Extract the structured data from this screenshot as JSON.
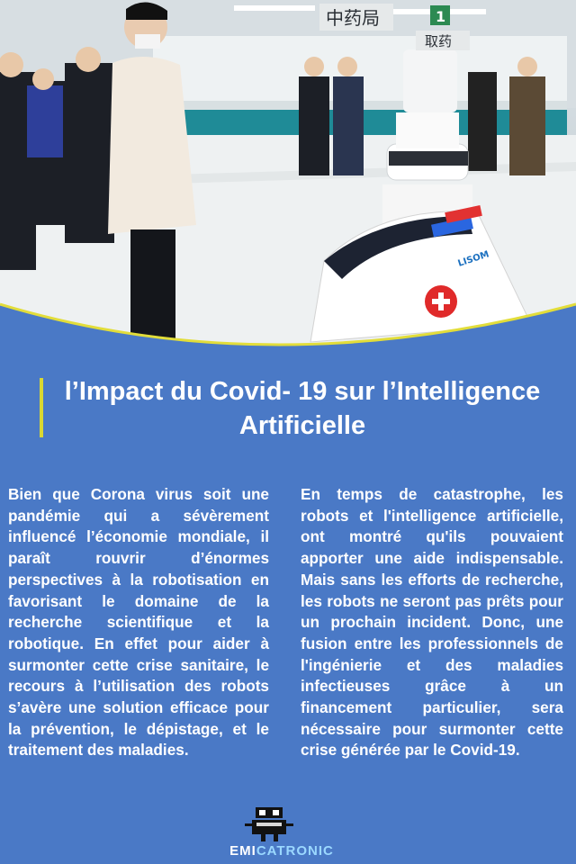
{
  "photo": {
    "sign_pharmacy": "中药局",
    "sign_number": "1",
    "sign_take_medicine": "取药",
    "robot_brand": "LISOM"
  },
  "title": {
    "line1": "l’Impact du Covid- 19 sur l’Intelligence",
    "line2": "Artificielle"
  },
  "body": {
    "left": "Bien que Corona virus soit une pandémie qui a sévèrement influencé l’économie mondiale, il paraît rouvrir d’énormes perspectives à la robotisation en favorisant le domaine de la recherche scientifique et la robotique. En effet pour aider à surmonter cette crise sanitaire, le recours à l’utilisation des robots s’avère une solution efficace pour la prévention, le dépistage, et le traitement des maladies.",
    "right": "En temps de catastrophe, les robots et l'intelligence artificielle, ont montré qu'ils pouvaient apporter une aide indispensable. Mais sans les efforts de recherche, les robots ne seront pas prêts pour un prochain incident. Donc, une fusion entre les professionnels de l'ingénierie et des maladies infectieuses grâce à un financement particulier, sera nécessaire pour surmonter cette crise générée par le Covid-19."
  },
  "logo": {
    "part1": "EMI",
    "part2": "CATRONIC"
  },
  "colors": {
    "background": "#4a79c6",
    "accent_bar": "#d9d832",
    "curve_line": "#e2dd3a"
  }
}
